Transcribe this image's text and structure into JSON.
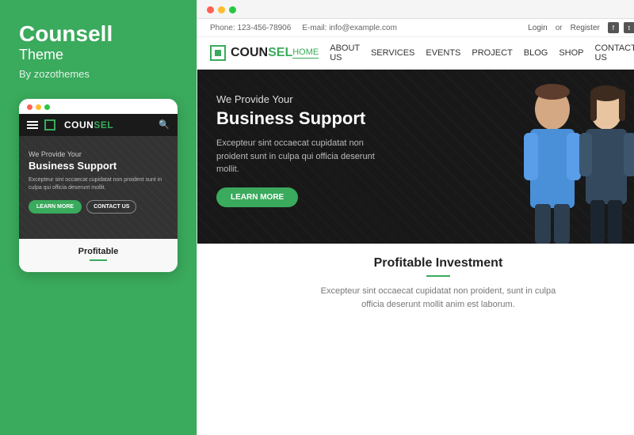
{
  "left": {
    "title": "Counsell",
    "subtitle": "Theme",
    "author": "By zozothemes",
    "dots": [
      "red",
      "yellow",
      "green"
    ]
  },
  "mobile": {
    "logo": "COUN",
    "logo_green": "SEL",
    "nav_dots": [
      "red",
      "yellow",
      "green"
    ],
    "hero": {
      "subtitle": "We Provide Your",
      "title": "Business Support",
      "desc": "Excepteur sint occaecat cupidatat non proident sunt in culpa qui officia deserunt mollit.",
      "btn_learn": "LEARN MORE",
      "btn_contact": "CONTACT US"
    },
    "section_title": "Profitable"
  },
  "desktop": {
    "info_bar": {
      "phone": "Phone: 123-456-78906",
      "email": "E-mail: info@example.com",
      "login": "Login",
      "or": "or",
      "register": "Register"
    },
    "logo": {
      "text_black": "COUN",
      "text_green": "SEL"
    },
    "nav": {
      "links": [
        "HOME",
        "ABOUT US",
        "SERVICES",
        "EVENTS",
        "PROJECT",
        "BLOG",
        "SHOP",
        "CONTACT US"
      ]
    },
    "hero": {
      "subtitle": "We Provide Your",
      "title": "Business Support",
      "desc": "Excepteur sint occaecat cupidatat non proident sunt in culpa qui officia deserunt mollit.",
      "btn_learn": "LEARN MORE"
    },
    "section": {
      "title": "Profitable Investment",
      "desc": "Excepteur sint occaecat cupidatat non proident, sunt in culpa officia deserunt mollit anim est laborum."
    }
  },
  "colors": {
    "green": "#3aaa5c",
    "dark": "#1a1a1a",
    "white": "#ffffff"
  }
}
